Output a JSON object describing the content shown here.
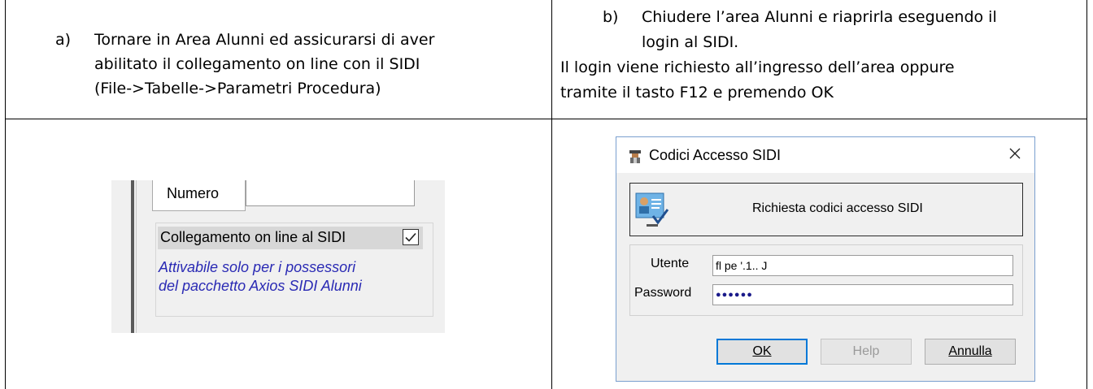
{
  "cells": {
    "a": {
      "marker": "a)",
      "lines": [
        "Tornare in Area Alunni ed assicurarsi di aver",
        "abilitato il collegamento on line con il SIDI",
        "(File->Tabelle->Parametri Procedura)"
      ]
    },
    "b": {
      "marker": "b)",
      "line1": "Chiudere l’area Alunni e riaprirla eseguendo il",
      "line2": "login al SIDI.",
      "line3": "Il login viene richiesto all’ingresso dell’area oppure",
      "line4": "tramite il tasto F12 e premendo OK"
    }
  },
  "left_screenshot": {
    "numero_label": "Numero",
    "collegamento_label": "Collegamento on line al SIDI",
    "checkbox_checked": true,
    "note_lines": [
      "Attivabile solo per i possessori",
      "del pacchetto Axios SIDI Alunni"
    ],
    "note_color": "#2a2ab4"
  },
  "dialog": {
    "title": "Codici Accesso SIDI",
    "close_icon": "close-icon",
    "banner_text": "Richiesta codici accesso SIDI",
    "utente_label": "Utente",
    "utente_value": "fl           pe         '.1.. J",
    "password_label": "Password",
    "password_value": "●●●●●●",
    "buttons": {
      "ok": "OK",
      "help": "Help",
      "annulla": "Annulla"
    },
    "accent": "#0078d7"
  }
}
